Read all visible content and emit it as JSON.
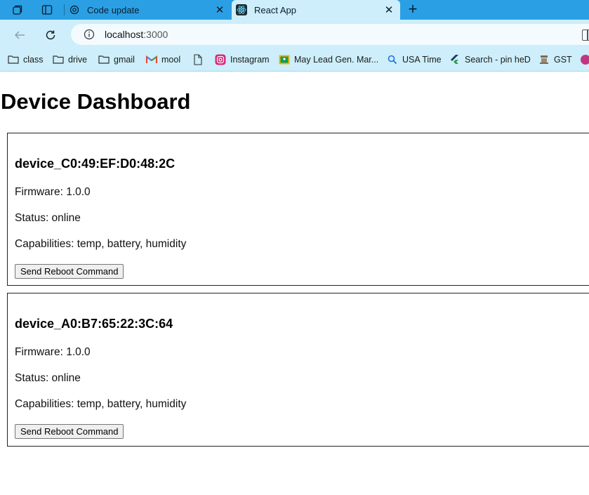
{
  "browser": {
    "tabs": [
      {
        "title": "Code update",
        "active": false
      },
      {
        "title": "React App",
        "active": true
      }
    ],
    "address": {
      "host": "localhost",
      "port": ":3000"
    },
    "bookmarks": [
      "class",
      "drive",
      "gmail",
      "mool",
      "",
      "Instagram",
      "May Lead Gen. Mar...",
      "USA Time",
      "Search - pin heD",
      "GST"
    ]
  },
  "page": {
    "title": "Device Dashboard",
    "devices": [
      {
        "name": "device_C0:49:EF:D0:48:2C",
        "firmware": "Firmware: 1.0.0",
        "status": "Status: online",
        "capabilities": "Capabilities: temp, battery, humidity",
        "button": "Send Reboot Command"
      },
      {
        "name": "device_A0:B7:65:22:3C:64",
        "firmware": "Firmware: 1.0.0",
        "status": "Status: online",
        "capabilities": "Capabilities: temp, battery, humidity",
        "button": "Send Reboot Command"
      }
    ]
  },
  "colors": {
    "tabbar": "#2b9fe4",
    "toolbar": "#cdeefa",
    "accent": "#2b9fe4"
  }
}
